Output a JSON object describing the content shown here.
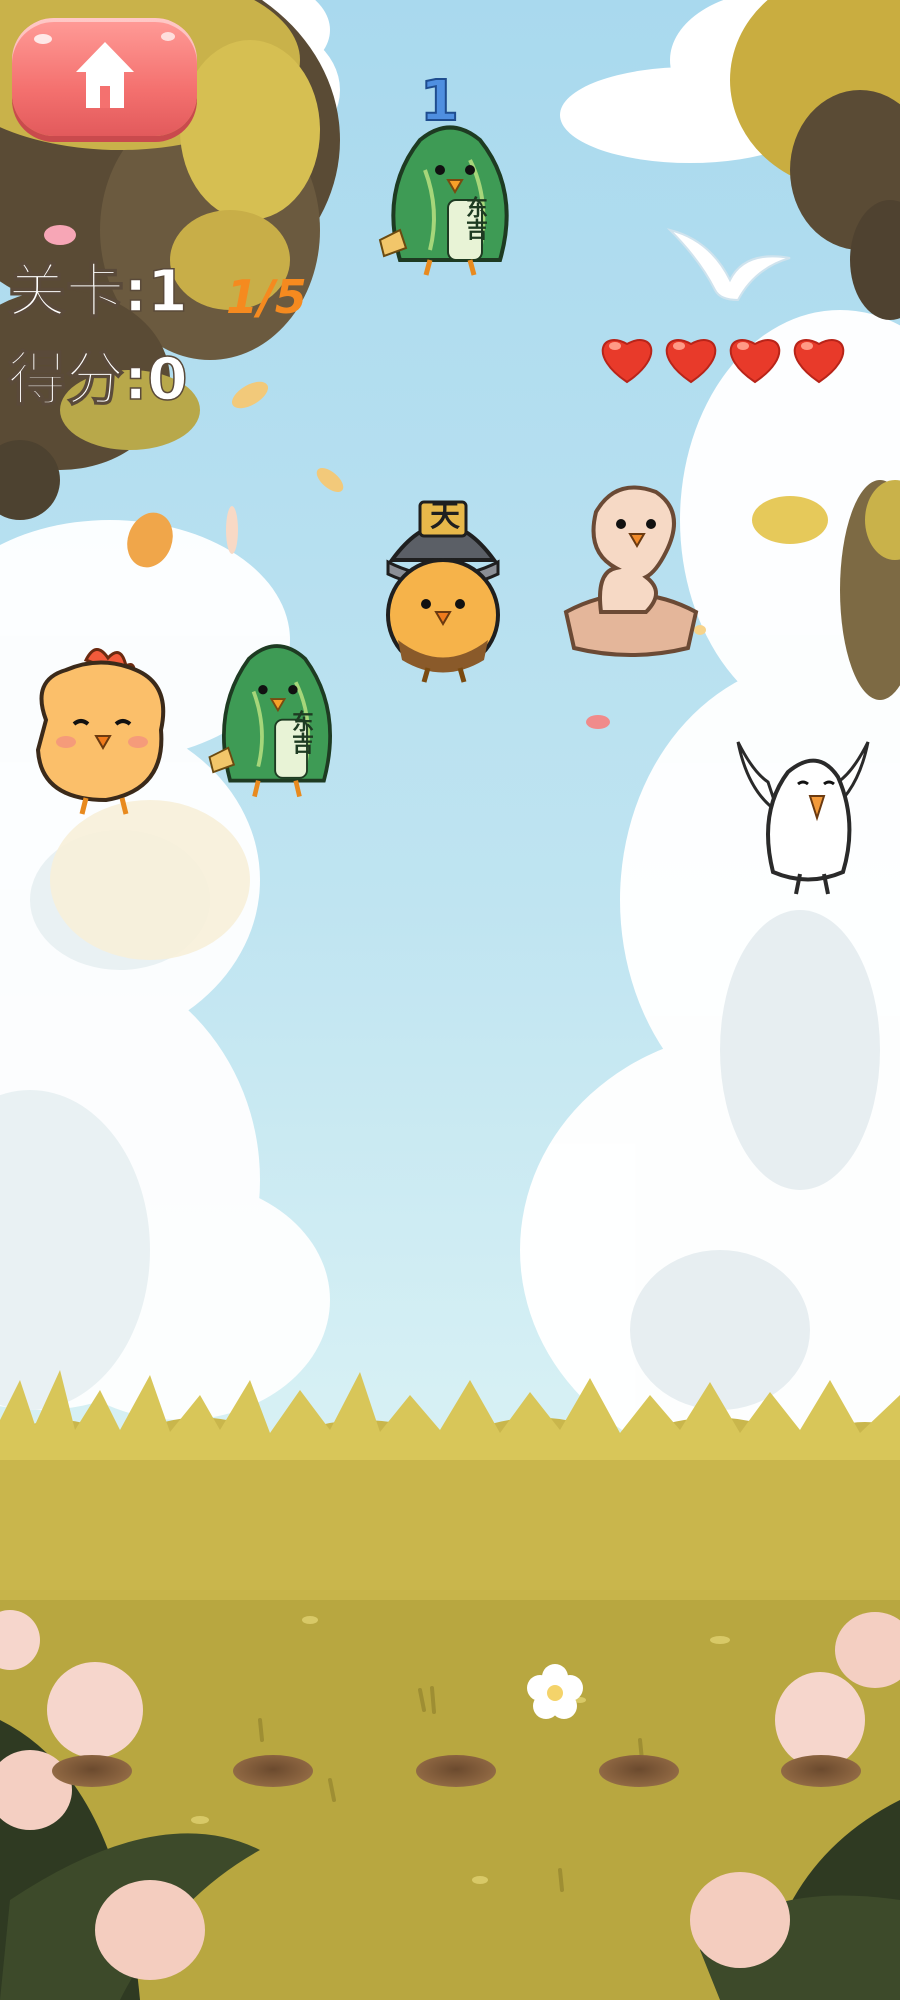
{
  "hud": {
    "level_label": "关卡:1",
    "level_progress": "1/5",
    "score_label": "得分:0",
    "lives": 4,
    "home_icon": "home-icon"
  },
  "characters": [
    {
      "name": "green-chick-costume",
      "badge": "东吉"
    },
    {
      "name": "combo-number",
      "text": "1"
    },
    {
      "name": "samurai-chick",
      "helmet_text": "天"
    },
    {
      "name": "orange-fluffy-chick"
    },
    {
      "name": "green-chick-costume-2",
      "badge": "东吉"
    },
    {
      "name": "cream-stone-chick"
    },
    {
      "name": "white-dove"
    }
  ],
  "holes": 5,
  "colors": {
    "home_button": "#f4716f",
    "progress": "#f58a1f",
    "heart": "#e83a2a"
  }
}
